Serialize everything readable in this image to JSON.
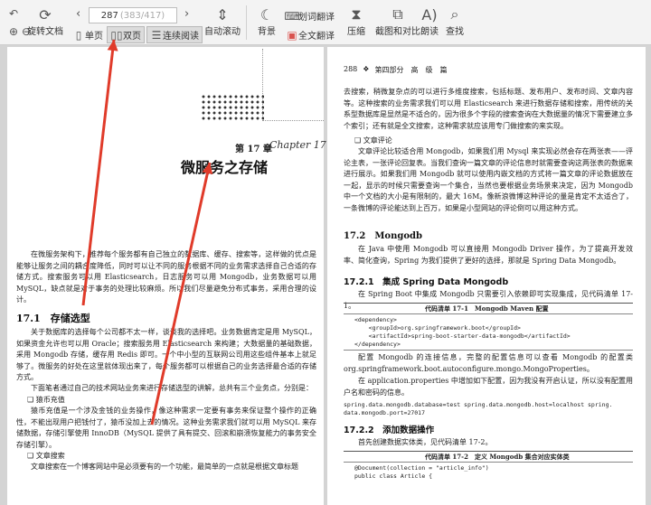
{
  "toolbar": {
    "rotate_label": "旋转文档",
    "page_current": "287",
    "page_total": "(383/417)",
    "single_page": "单页",
    "double_page": "双页",
    "continuous": "连续阅读",
    "auto_scroll": "自动滚动",
    "background": "背景",
    "translate_word": "划词翻译",
    "translate_full": "全文翻译",
    "compress": "压缩",
    "screenshot_compare": "截图和对比",
    "read_aloud": "朗读",
    "find": "查找"
  },
  "left_page": {
    "chapter_num": "第 17 章",
    "chapter_script": "Chapter 17",
    "chapter_title": "微服务之存储",
    "intro": "在微服务架构下，推荐每个服务都有自己独立的数据库、缓存、搜索等，这样做的优点是能够让服务之间的耦合度降低，同时可以让不同的服务根据不同的业务需求选择自己合适的存储方式。搜索服务可以用 Elasticsearch，日志服务可以用 Mongodb，业务数据可以用 MySQL，缺点就是对于事务的处理比较麻烦。所以我们尽量避免分布式事务，采用合理的设计。",
    "sec1_title": "17.1　存储选型",
    "sec1_para1": "关于数据库的选择每个公司都不太一样，谈谈我的选择吧。业务数据肯定是用 MySQL，如果资金允许也可以用 Oracle；搜索服务用 Elasticsearch 来构建；大数据量的基础数据，采用 Mongodb 存储，缓存用 Redis 即可。一个中小型的互联网公司用这些组件基本上就足够了。微服务的好处在这里就体现出来了，每个服务都可以根据自己的业务选择最合适的存储方式。",
    "sec1_para2": "下面笔者通过自己的技术网站业务来进行存储选型的讲解，总共有三个业务点，分别是：",
    "bullet1": "❑ 猿币充值",
    "bullet1_text": "猿币充值是一个涉及金钱的业务操作，像这种需求一定要有事务来保证整个操作的正确性，不能出现用户把钱付了，猿币没加上去的情况。这种业务需求我们就可以用 MySQL 来存储数据，存储引擎使用 InnoDB（MySQL 提供了具有提交、回滚和崩溃恢复能力的事务安全存储引擎）。",
    "bullet2": "❑ 文章搜索",
    "bullet2_text": "文章搜索在一个博客网站中是必须要有的一个功能，最简单的一点就是根据文章标题"
  },
  "right_page": {
    "page_no": "288",
    "part_label": "第四部分　高　级　篇",
    "para1": "去搜索，稍微复杂点的可以进行多维度搜索，包括标题、发布用户、发布时间、文章内容等。这种搜索的业务需求我们可以用 Elasticsearch 来进行数据存储和搜索，用传统的关系型数据库是显然是不适合的，因为很多个字段的搜索查询在大数据量的情况下需要建立多个索引；还有就是全文搜索，这种需求就应该用专门做搜索的来实现。",
    "bullet3": "❑ 文章评论",
    "para2": "文章评论比较适合用 Mongodb，如果我们用 Mysql 来实现必然会存在两张表——评论主表，一张评论回复表。当我们查询一篇文章的评论信息时就需要查询这两张表的数据来进行展示。如果我们用 Mongodb 就可以使用内嵌文档的方式将一篇文章的评论数据放在一起，显示的时候只需要查询一个集合，当然也要根据业务场景来决定，因为 Mongodb 中一个文档的大小是有限制的，最大 16M。像新浪微博这种评论的量是肯定不太适合了，一条微博的评论能达到上百万，如果是小型网站的评论倒可以用这种方式。",
    "sec2_title": "17.2　Mongodb",
    "sec2_para": "在 Java 中使用 Mongodb 可以直接用 Mongodb Driver 操作，为了提高开发效率、简化查询，Spring 为我们提供了更好的选择，那就是 Spring Data Mongodb。",
    "sec21_title": "17.2.1　集成 Spring Data Mongodb",
    "sec21_para": "在 Spring Boot 中集成 Mongodb 只需要引入依赖即可实现集成，见代码清单 17-1。",
    "code1_caption": "代码清单 17-1　Mongodb Maven 配置",
    "code1": "<dependency>\n    <groupId>org.springframework.boot</groupId>\n    <artifactId>spring-boot-starter-data-mongodb</artifactId>\n</dependency>",
    "sec21_para2": "配置 Mongodb 的连接信息，完整的配置信息可以查看 Mongodb 的配置类 org.springframework.boot.autoconfigure.mongo.MongoProperties。",
    "sec21_para3": "在 application.properties 中增加如下配置，因为我没有开启认证，所以没有配置用户名和密码的信息。",
    "code2": "spring.data.mongodb.database=test spring.data.mongodb.host=localhost spring.\ndata.mongodb.port=27017",
    "sec22_title": "17.2.2　添加数据操作",
    "sec22_para": "首先创建数据实体类，见代码清单 17-2。",
    "code2_caption": "代码清单 17-2　定义 Mongodb 集合对应实体类",
    "code3": "@Document(collection = \"article_info\")\npublic class Article {"
  },
  "colors": {
    "arrow": "#e03b2a"
  }
}
